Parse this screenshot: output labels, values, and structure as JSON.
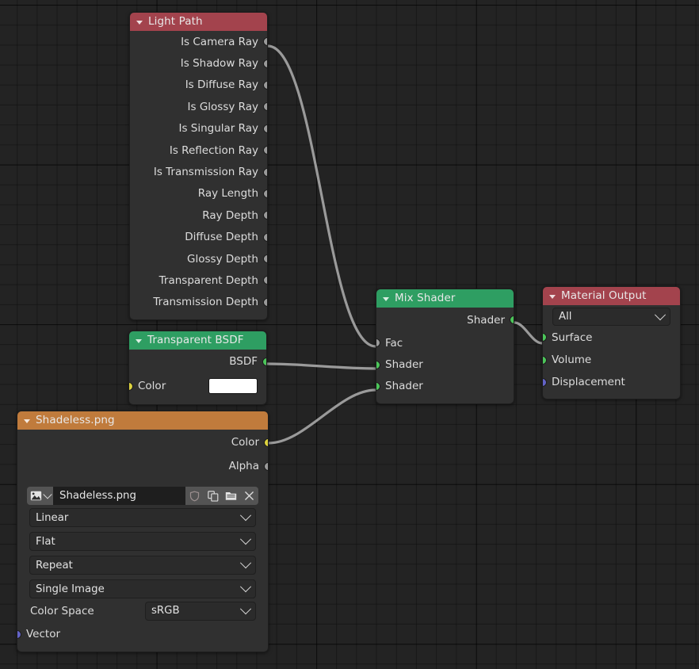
{
  "app": {
    "editor": "shader-node-editor",
    "background_color": "#232323",
    "grid_line_color": "#1a1a1a"
  },
  "colors": {
    "header_input_red": "#a3434d",
    "header_shader_green": "#2e9e62",
    "header_texture_orange": "#c07b3c",
    "node_body": "#303030",
    "socket_gray": "#9a9a9a",
    "socket_shader_green": "#4cc55a",
    "socket_color_yellow": "#ddd33f",
    "socket_vector_purple": "#6363c7",
    "link_color": "#9a9a9a"
  },
  "nodes": {
    "light_path": {
      "title": "Light Path",
      "outputs": [
        {
          "label": "Is Camera Ray",
          "socket": "gray"
        },
        {
          "label": "Is Shadow Ray",
          "socket": "gray"
        },
        {
          "label": "Is Diffuse Ray",
          "socket": "gray"
        },
        {
          "label": "Is Glossy Ray",
          "socket": "gray"
        },
        {
          "label": "Is Singular Ray",
          "socket": "gray"
        },
        {
          "label": "Is Reflection Ray",
          "socket": "gray"
        },
        {
          "label": "Is Transmission Ray",
          "socket": "gray"
        },
        {
          "label": "Ray Length",
          "socket": "gray"
        },
        {
          "label": "Ray Depth",
          "socket": "gray"
        },
        {
          "label": "Diffuse Depth",
          "socket": "gray"
        },
        {
          "label": "Glossy Depth",
          "socket": "gray"
        },
        {
          "label": "Transparent Depth",
          "socket": "gray"
        },
        {
          "label": "Transmission Depth",
          "socket": "gray"
        }
      ]
    },
    "transparent_bsdf": {
      "title": "Transparent BSDF",
      "output_label": "BSDF",
      "color_label": "Color",
      "color_value": "#ffffff"
    },
    "mix_shader": {
      "title": "Mix Shader",
      "output_label": "Shader",
      "inputs": [
        {
          "label": "Fac",
          "socket": "gray"
        },
        {
          "label": "Shader",
          "socket": "green"
        },
        {
          "label": "Shader",
          "socket": "green"
        }
      ]
    },
    "material_output": {
      "title": "Material Output",
      "target_value": "All",
      "inputs": [
        {
          "label": "Surface",
          "socket": "green"
        },
        {
          "label": "Volume",
          "socket": "green"
        },
        {
          "label": "Displacement",
          "socket": "purple"
        }
      ]
    },
    "image_texture": {
      "title": "Shadeless.png",
      "outputs": [
        {
          "label": "Color",
          "socket": "yellow"
        },
        {
          "label": "Alpha",
          "socket": "gray"
        }
      ],
      "datablock": {
        "browse_icon": "image-icon",
        "name": "Shadeless.png",
        "fake_user_icon": "shield-icon",
        "new_icon": "duplicate-icon",
        "open_icon": "folder-icon",
        "unlink_icon": "close-icon"
      },
      "interpolation": "Linear",
      "projection": "Flat",
      "extension": "Repeat",
      "source": "Single Image",
      "color_space_label": "Color Space",
      "color_space_value": "sRGB",
      "vector_label": "Vector"
    }
  },
  "links": [
    {
      "from": "light_path.Is Camera Ray",
      "to": "mix_shader.Fac"
    },
    {
      "from": "transparent_bsdf.BSDF",
      "to": "mix_shader.Shader1"
    },
    {
      "from": "image_texture.Color",
      "to": "mix_shader.Shader2"
    },
    {
      "from": "mix_shader.Shader",
      "to": "material_output.Surface"
    }
  ]
}
